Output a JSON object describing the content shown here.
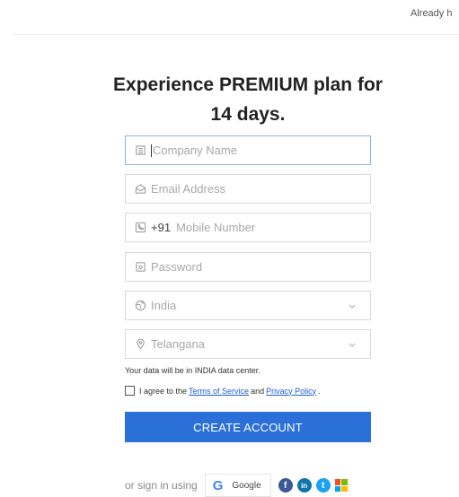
{
  "header": {
    "signin_prompt": "Already h"
  },
  "headline": {
    "line1": "Experience PREMIUM plan for",
    "line2": "14 days."
  },
  "form": {
    "company_placeholder": "Company Name",
    "email_placeholder": "Email Address",
    "country_code": "+91",
    "mobile_placeholder": "Mobile Number",
    "password_placeholder": "Password",
    "country_value": "India",
    "state_value": "Telangana",
    "data_center_note": "Your data will be in INDIA data center.",
    "agree_prefix": "I agree to the",
    "terms_link": "Terms of Service",
    "agree_and": "and",
    "privacy_link": "Privacy Policy",
    "agree_suffix": ".",
    "submit_label": "CREATE ACCOUNT"
  },
  "social": {
    "prefix": "or sign in using",
    "google_label": "Google",
    "google_glyph": "G",
    "facebook_glyph": "f",
    "linkedin_glyph": "in",
    "twitter_glyph": "t",
    "icons": [
      "google-icon",
      "facebook-icon",
      "linkedin-icon",
      "twitter-icon",
      "microsoft-icon"
    ]
  },
  "colors": {
    "accent": "#2b6fd8",
    "link": "#1a5ddb",
    "focus_border": "#8fb3e6"
  }
}
